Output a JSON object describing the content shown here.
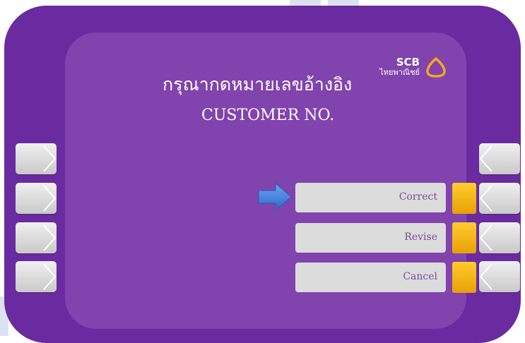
{
  "screen": {
    "title_thai": "กรุณากดหมายเลขอ้างอิง",
    "title_english": "CUSTOMER NO."
  },
  "logo": {
    "brand": "SCB",
    "thai_name": "ไทยพาณิชย์",
    "mark": "scb-emblem-icon"
  },
  "options": [
    {
      "label": "Correct",
      "selected": true
    },
    {
      "label": "Revise"
    },
    {
      "label": "Cancel"
    }
  ],
  "selection_pointer": "blue-arrow-icon",
  "left_keys": [
    "chevron-right-icon",
    "chevron-right-icon",
    "chevron-right-icon",
    "chevron-right-icon"
  ],
  "right_keys": [
    "chevron-left-icon",
    "chevron-left-icon",
    "chevron-left-icon",
    "chevron-left-icon"
  ],
  "colors": {
    "frame": "#6a2aa0",
    "screen": "#8143ad",
    "option_button": "#dcdcdc",
    "option_text": "#7a4c9a",
    "indicator": "#f5b616",
    "arrow": "#3f7ee0",
    "logo_mark": "#f5a623"
  }
}
